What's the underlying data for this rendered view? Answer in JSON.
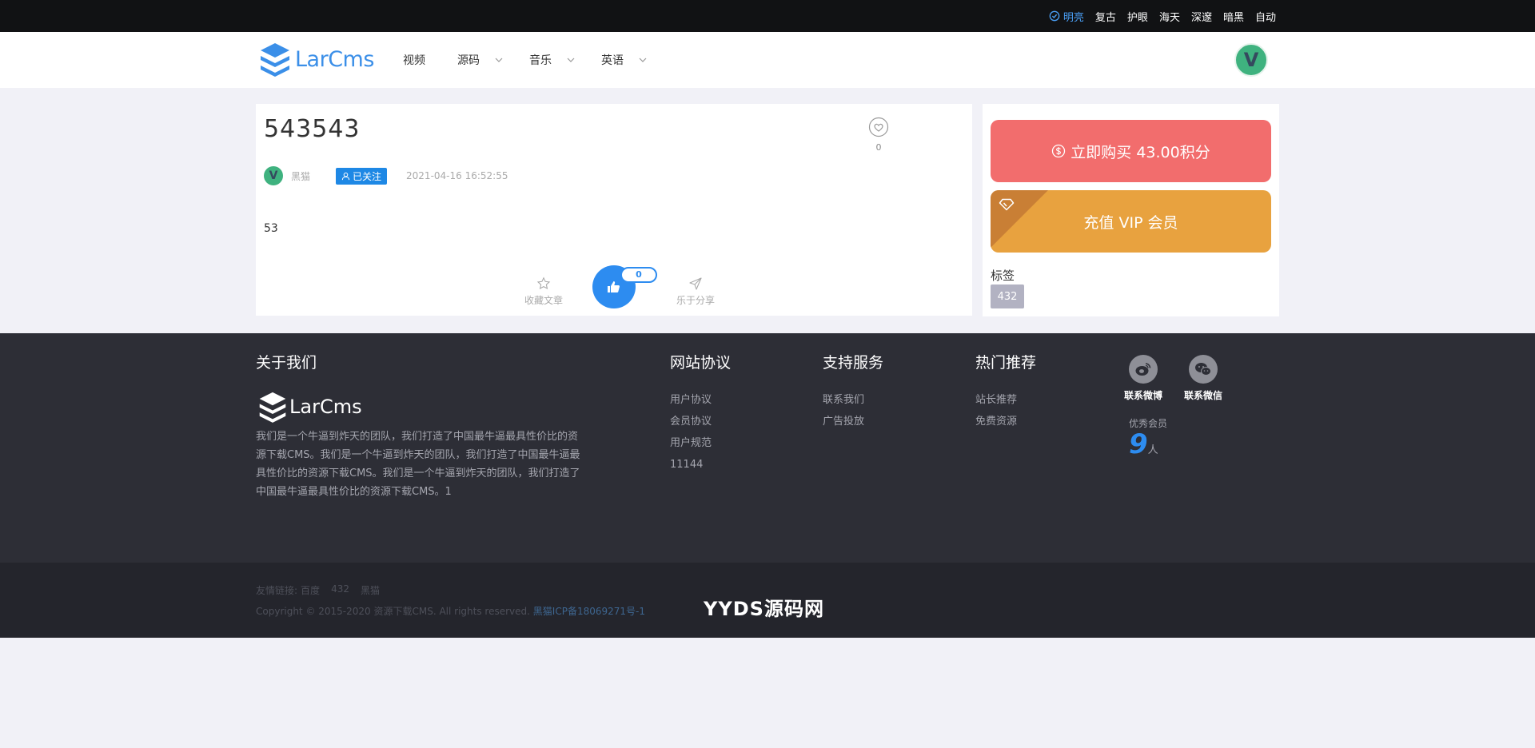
{
  "themes": [
    {
      "label": "明亮",
      "active": true
    },
    {
      "label": "复古"
    },
    {
      "label": "护眼"
    },
    {
      "label": "海天"
    },
    {
      "label": "深邃"
    },
    {
      "label": "暗黑"
    },
    {
      "label": "自动"
    }
  ],
  "header": {
    "logo_text": "LarCms",
    "nav": [
      "视频",
      "源码",
      "音乐",
      "英语"
    ],
    "avatar_letter": "V"
  },
  "article": {
    "title": "543543",
    "like_count": "0",
    "author_avatar": "V",
    "author": "黑猫",
    "follow_label": "已关注",
    "date": "2021-04-16 16:52:55",
    "body": "53",
    "favorite_label": "收藏文章",
    "share_label": "乐于分享",
    "thumb_count": "0"
  },
  "sidebar": {
    "buy_label": "立即购买 43.00积分",
    "vip_label": "充值 VIP 会员",
    "tags_label": "标签",
    "tags": [
      "432"
    ]
  },
  "footer": {
    "about_title": "关于我们",
    "logo_text": "LarCms",
    "about_text": "我们是一个牛逼到炸天的团队，我们打造了中国最牛逼最具性价比的资源下载CMS。我们是一个牛逼到炸天的团队，我们打造了中国最牛逼最具性价比的资源下载CMS。我们是一个牛逼到炸天的团队，我们打造了中国最牛逼最具性价比的资源下载CMS。1",
    "protocol_title": "网站协议",
    "protocol_links": [
      "用户协议",
      "会员协议",
      "用户规范",
      "11144"
    ],
    "support_title": "支持服务",
    "support_links": [
      "联系我们",
      "广告投放"
    ],
    "hot_title": "热门推荐",
    "hot_links": [
      "站长推荐",
      "免费资源"
    ],
    "weibo_label": "联系微博",
    "wechat_label": "联系微信",
    "members_label": "优秀会员",
    "members_count": "9",
    "members_unit": "人"
  },
  "bottom": {
    "friend_links_label": "友情链接:",
    "friend_links": [
      "百度",
      "432",
      "黑猫"
    ],
    "copyright": "Copyright © 2015-2020 资源下载CMS. All rights reserved.",
    "icp": "黑猫ICP备18069271号-1",
    "watermark": "YYDS源码网"
  },
  "colors": {
    "accent": "#2d8cf0",
    "buy": "#f26d6d",
    "vip": "#e8a23f",
    "footer_bg": "#2d2e36"
  }
}
